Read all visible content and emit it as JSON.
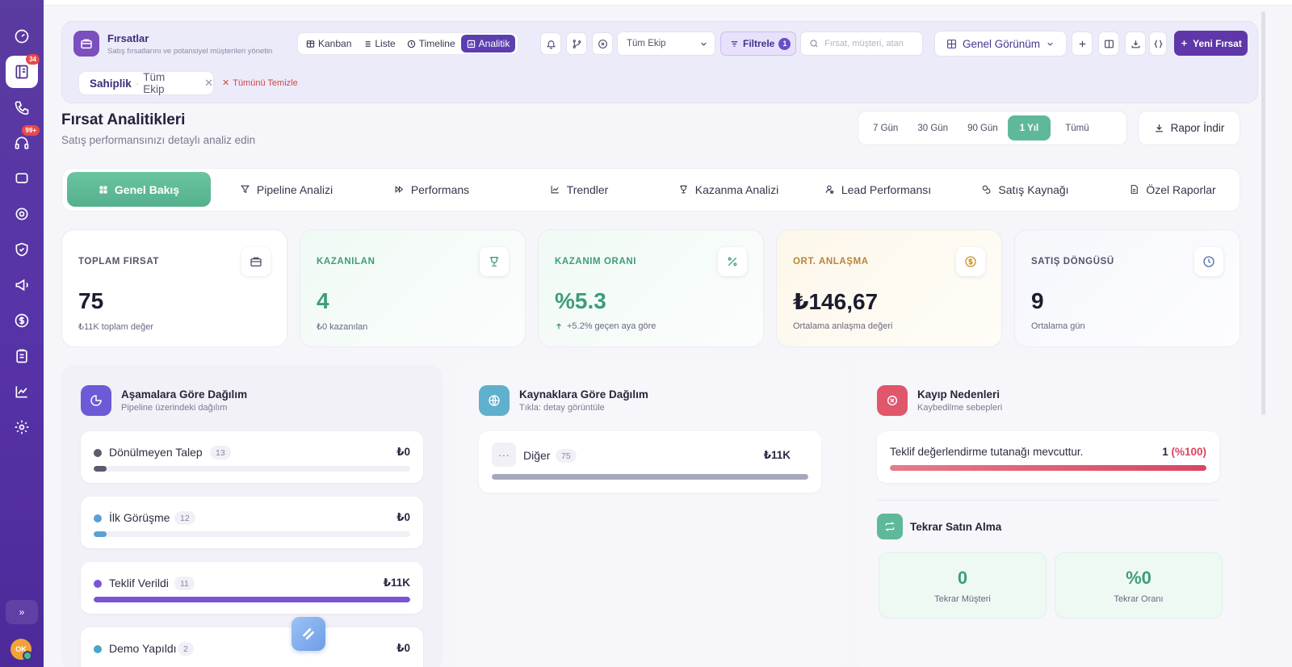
{
  "sidebar": {
    "items": [
      {
        "name": "dashboard",
        "badge": ""
      },
      {
        "name": "opportunities",
        "badge": "34"
      },
      {
        "name": "calls",
        "badge": ""
      },
      {
        "name": "support",
        "badge": "99+"
      },
      {
        "name": "messages",
        "badge": ""
      },
      {
        "name": "campaign-target",
        "badge": ""
      },
      {
        "name": "security",
        "badge": ""
      },
      {
        "name": "announcements",
        "badge": ""
      },
      {
        "name": "finance",
        "badge": ""
      },
      {
        "name": "clipboard",
        "badge": ""
      },
      {
        "name": "reports",
        "badge": ""
      },
      {
        "name": "settings",
        "badge": ""
      }
    ],
    "avatar_initials": "OK",
    "expand_label": "»"
  },
  "toolbar": {
    "title": "Fırsatlar",
    "subtitle": "Satış fırsatlarını ve potansiyel müşterileri yönetin",
    "views": [
      "Kanban",
      "Liste",
      "Timeline",
      "Analitik"
    ],
    "active_view": "Analitik",
    "team_select": "Tüm Ekip",
    "filter_label": "Filtrele",
    "filter_count": "1",
    "search_placeholder": "Fırsat, müşteri, atan",
    "view_mode": "Genel Görünüm",
    "new_button": "Yeni Fırsat",
    "chip_key": "Sahiplik",
    "chip_value": "Tüm Ekip",
    "clear_all": "Tümünü Temizle"
  },
  "header": {
    "title": "Fırsat Analitikleri",
    "subtitle": "Satış performansınızı detaylı analiz edin",
    "periods": [
      "7 Gün",
      "30 Gün",
      "90 Gün",
      "1 Yıl",
      "Tümü"
    ],
    "active_period": "1 Yıl",
    "report_button": "Rapor İndir"
  },
  "tabs": [
    "Genel Bakış",
    "Pipeline Analizi",
    "Performans",
    "Trendler",
    "Kazanma Analizi",
    "Lead Performansı",
    "Satış Kaynağı",
    "Özel Raporlar"
  ],
  "stats": [
    {
      "label": "TOPLAM FIRSAT",
      "value": "75",
      "foot": "₺11K toplam değer",
      "color": "#1d1b2e",
      "label_color": "#55526a"
    },
    {
      "label": "KAZANILAN",
      "value": "4",
      "foot": "₺0 kazanılan",
      "color": "#3e9d7a",
      "label_color": "#3e9d7a"
    },
    {
      "label": "KAZANIM ORANI",
      "value": "%5.3",
      "foot": "+5.2% geçen aya göre",
      "color": "#3e9d7a",
      "label_color": "#3e9d7a"
    },
    {
      "label": "ORT. ANLAŞMA",
      "value": "₺146,67",
      "foot": "Ortalama anlaşma değeri",
      "color": "#1d1b2e",
      "label_color": "#b8843a"
    },
    {
      "label": "SATIŞ DÖNGÜSÜ",
      "value": "9",
      "foot": "Ortalama gün",
      "color": "#1d1b2e",
      "label_color": "#55526a"
    }
  ],
  "stages": {
    "title": "Aşamalara Göre Dağılım",
    "subtitle": "Pipeline üzerindeki dağılım",
    "rows": [
      {
        "name": "Dönülmeyen Talep",
        "count": "13",
        "amount": "₺0",
        "color": "#5c5a6b",
        "fill": 0.04
      },
      {
        "name": "İlk Görüşme",
        "count": "12",
        "amount": "₺0",
        "color": "#5a9fd6",
        "fill": 0.04
      },
      {
        "name": "Teklif Verildi",
        "count": "11",
        "amount": "₺11K",
        "color": "#7a55d6",
        "fill": 1.0
      },
      {
        "name": "Demo Yapıldı",
        "count": "2",
        "amount": "₺0",
        "color": "#4aa5c9",
        "fill": 0.02
      }
    ]
  },
  "sources": {
    "title": "Kaynaklara Göre Dağılım",
    "subtitle": "Tıkla: detay görüntüle",
    "rows": [
      {
        "name": "Diğer",
        "count": "75",
        "amount": "₺11K",
        "color": "#a6a9bd",
        "fill": 1.0
      }
    ]
  },
  "loss": {
    "title": "Kayıp Nedenleri",
    "subtitle": "Kaybedilme sebepleri",
    "rows": [
      {
        "name": "Teklif değerlendirme tutanağı mevcuttur.",
        "count": "1",
        "pct": "(%100)",
        "fill": 1.0
      }
    ]
  },
  "repeat": {
    "title": "Tekrar Satın Alma",
    "customers_value": "0",
    "customers_label": "Tekrar Müşteri",
    "rate_value": "%0",
    "rate_label": "Tekrar Oranı"
  },
  "colors": {
    "accent": "#5b3fb0",
    "success": "#5fb89a",
    "danger": "#d9455f"
  }
}
